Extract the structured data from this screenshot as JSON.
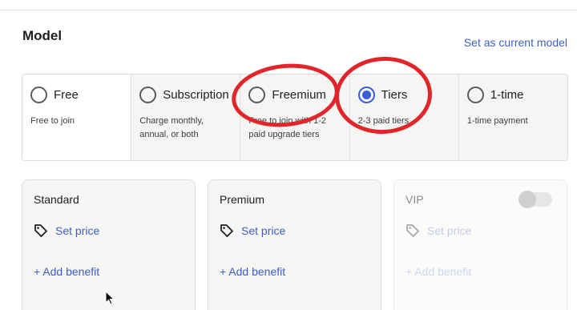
{
  "section": {
    "title": "Model",
    "set_current_label": "Set as current model"
  },
  "model_options": [
    {
      "label": "Free",
      "description": "Free to join",
      "selected": false
    },
    {
      "label": "Subscription",
      "description": "Charge monthly, annual, or both",
      "selected": false
    },
    {
      "label": "Freemium",
      "description": "Free to join with 1-2 paid upgrade tiers",
      "selected": false
    },
    {
      "label": "Tiers",
      "description": "2-3 paid tiers",
      "selected": true
    },
    {
      "label": "1-time",
      "description": "1-time payment",
      "selected": false
    }
  ],
  "tiers": [
    {
      "name": "Standard",
      "set_price_label": "Set price",
      "add_benefit_label": "+ Add benefit",
      "enabled": true
    },
    {
      "name": "Premium",
      "set_price_label": "Set price",
      "add_benefit_label": "+ Add benefit",
      "enabled": true
    },
    {
      "name": "VIP",
      "set_price_label": "Set price",
      "add_benefit_label": "+ Add benefit",
      "enabled": false
    }
  ],
  "colors": {
    "accent": "#3a5bd9",
    "link": "#3d5fc4",
    "annotation": "#e0262b"
  },
  "icons": {
    "price": "price-tag-icon",
    "cursor": "mouse-pointer-icon"
  }
}
